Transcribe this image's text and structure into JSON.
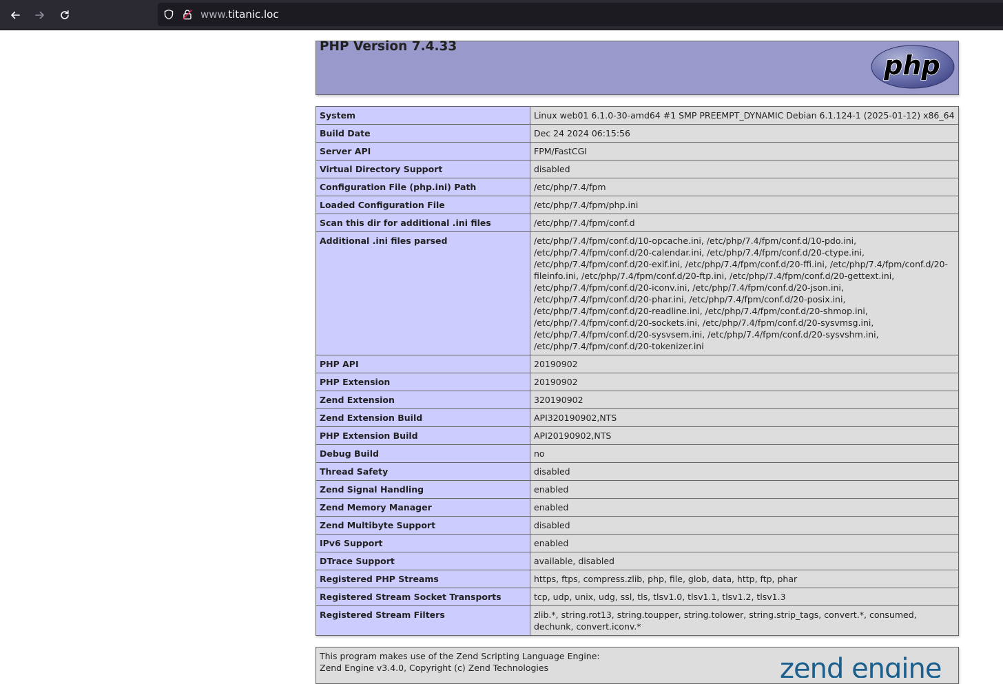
{
  "browser": {
    "url_prefix": "www.",
    "url_host": "titanic.loc"
  },
  "header": {
    "title": "PHP Version 7.4.33",
    "logo_text": "php"
  },
  "settings": [
    {
      "key": "System",
      "value": "Linux web01 6.1.0-30-amd64 #1 SMP PREEMPT_DYNAMIC Debian 6.1.124-1 (2025-01-12) x86_64"
    },
    {
      "key": "Build Date",
      "value": "Dec 24 2024 06:15:56"
    },
    {
      "key": "Server API",
      "value": "FPM/FastCGI"
    },
    {
      "key": "Virtual Directory Support",
      "value": "disabled"
    },
    {
      "key": "Configuration File (php.ini) Path",
      "value": "/etc/php/7.4/fpm"
    },
    {
      "key": "Loaded Configuration File",
      "value": "/etc/php/7.4/fpm/php.ini"
    },
    {
      "key": "Scan this dir for additional .ini files",
      "value": "/etc/php/7.4/fpm/conf.d"
    },
    {
      "key": "Additional .ini files parsed",
      "value": "/etc/php/7.4/fpm/conf.d/10-opcache.ini, /etc/php/7.4/fpm/conf.d/10-pdo.ini, /etc/php/7.4/fpm/conf.d/20-calendar.ini, /etc/php/7.4/fpm/conf.d/20-ctype.ini, /etc/php/7.4/fpm/conf.d/20-exif.ini, /etc/php/7.4/fpm/conf.d/20-ffi.ini, /etc/php/7.4/fpm/conf.d/20-fileinfo.ini, /etc/php/7.4/fpm/conf.d/20-ftp.ini, /etc/php/7.4/fpm/conf.d/20-gettext.ini, /etc/php/7.4/fpm/conf.d/20-iconv.ini, /etc/php/7.4/fpm/conf.d/20-json.ini, /etc/php/7.4/fpm/conf.d/20-phar.ini, /etc/php/7.4/fpm/conf.d/20-posix.ini, /etc/php/7.4/fpm/conf.d/20-readline.ini, /etc/php/7.4/fpm/conf.d/20-shmop.ini, /etc/php/7.4/fpm/conf.d/20-sockets.ini, /etc/php/7.4/fpm/conf.d/20-sysvmsg.ini, /etc/php/7.4/fpm/conf.d/20-sysvsem.ini, /etc/php/7.4/fpm/conf.d/20-sysvshm.ini, /etc/php/7.4/fpm/conf.d/20-tokenizer.ini"
    },
    {
      "key": "PHP API",
      "value": "20190902"
    },
    {
      "key": "PHP Extension",
      "value": "20190902"
    },
    {
      "key": "Zend Extension",
      "value": "320190902"
    },
    {
      "key": "Zend Extension Build",
      "value": "API320190902,NTS"
    },
    {
      "key": "PHP Extension Build",
      "value": "API20190902,NTS"
    },
    {
      "key": "Debug Build",
      "value": "no"
    },
    {
      "key": "Thread Safety",
      "value": "disabled"
    },
    {
      "key": "Zend Signal Handling",
      "value": "enabled"
    },
    {
      "key": "Zend Memory Manager",
      "value": "enabled"
    },
    {
      "key": "Zend Multibyte Support",
      "value": "disabled"
    },
    {
      "key": "IPv6 Support",
      "value": "enabled"
    },
    {
      "key": "DTrace Support",
      "value": "available, disabled"
    },
    {
      "key": "Registered PHP Streams",
      "value": "https, ftps, compress.zlib, php, file, glob, data, http, ftp, phar"
    },
    {
      "key": "Registered Stream Socket Transports",
      "value": "tcp, udp, unix, udg, ssl, tls, tlsv1.0, tlsv1.1, tlsv1.2, tlsv1.3"
    },
    {
      "key": "Registered Stream Filters",
      "value": "zlib.*, string.rot13, string.toupper, string.tolower, string.strip_tags, convert.*, consumed, dechunk, convert.iconv.*"
    }
  ],
  "footer": {
    "line1": "This program makes use of the Zend Scripting Language Engine:",
    "line2": "Zend Engine v3.4.0, Copyright (c) Zend Technologies",
    "logo_text": "zend engine"
  },
  "colors": {
    "header_bg": "#9999cc",
    "key_bg": "#ccccff",
    "value_bg": "#dddddd",
    "toolbar_bg": "#2b2a33"
  },
  "icons": [
    "back-arrow-icon",
    "forward-arrow-icon",
    "reload-icon",
    "shield-icon",
    "insecure-lock-icon"
  ]
}
